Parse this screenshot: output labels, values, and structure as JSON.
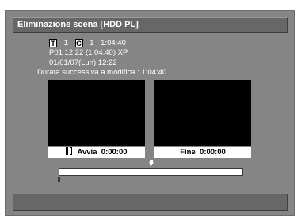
{
  "dialog": {
    "title": "Eliminazione scena [HDD PL]"
  },
  "info": {
    "title_box": "T",
    "title_number": "1",
    "chapter_box": "C",
    "chapter_number": "1",
    "chapter_duration": "1:04:40",
    "program_line": "P01  12:22 (1:04:40) XP",
    "date_line": "01/01/07(Lun)  12:22",
    "duration_line": "Durata successiva a modifica : 1:04:40"
  },
  "start": {
    "label": "Avvia",
    "time": "0:00:00"
  },
  "end": {
    "label": "Fine",
    "time": "0:00:00"
  },
  "timeline": {
    "position": 0
  },
  "icons": {
    "pause": "pause-icon",
    "marker": "position-marker-icon"
  }
}
